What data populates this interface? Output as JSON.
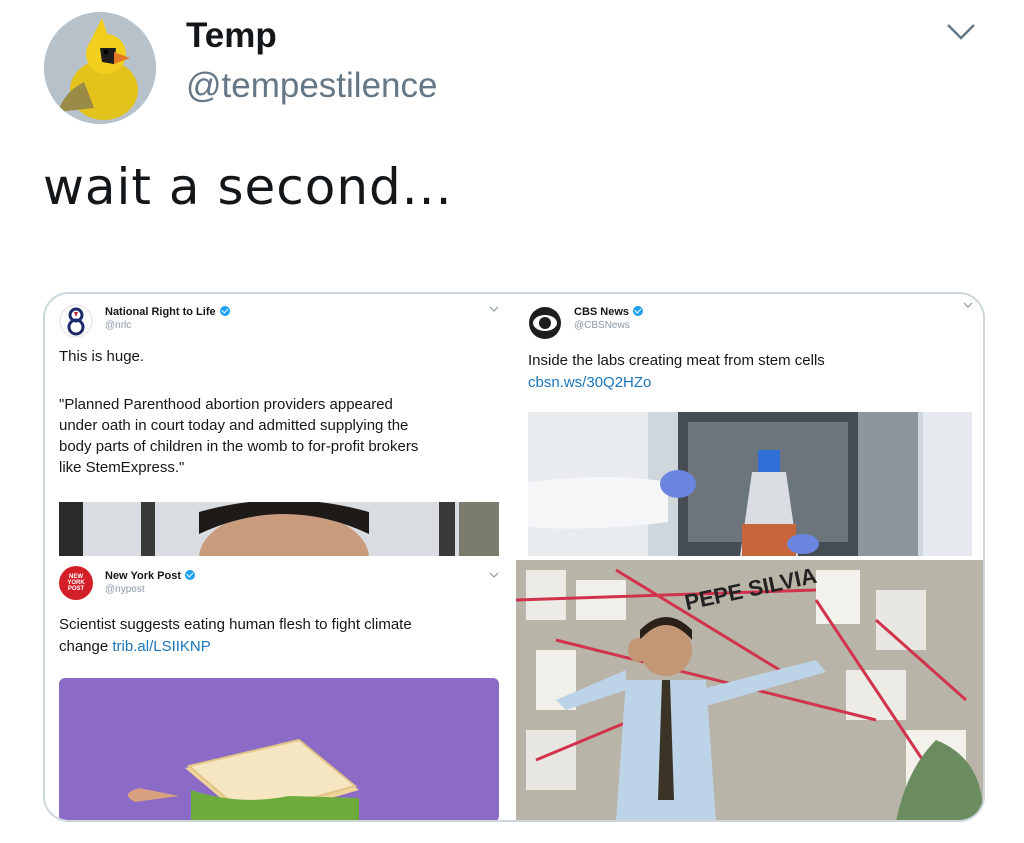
{
  "author": {
    "name": "Temp",
    "handle": "@tempestilence"
  },
  "tweet": {
    "text": "wait a second..."
  },
  "embedded": {
    "nrl": {
      "name": "National Right to Life",
      "handle": "@nrlc",
      "text_line1": "This is huge.",
      "quote_lines": [
        "\"Planned Parenthood abortion providers appeared",
        "under oath in court today and admitted supplying the",
        "body parts of children in the womb to for-profit brokers",
        "like StemExpress.\""
      ]
    },
    "cbs": {
      "name": "CBS News",
      "handle": "@CBSNews",
      "text": "Inside the labs creating meat from stem cells",
      "link": "cbsn.ws/30Q2HZo"
    },
    "nypost": {
      "name": "New York Post",
      "handle": "@nypost",
      "avatar_text": "NEW YORK POST",
      "text_line1": "Scientist suggests eating human flesh to fight climate",
      "text_line2": "change ",
      "link": "trib.al/LSIIKNP"
    },
    "meme": {
      "wall_text": "PEPE SILVIA"
    }
  },
  "icons": [
    "chevron-down-icon",
    "verified-badge-icon",
    "cardinal-bird-avatar",
    "nrl-logo-icon",
    "cbs-eye-logo-icon"
  ],
  "colors": {
    "link": "#1b75bb",
    "verified": "#1da1f2",
    "handle": "#657786",
    "border": "#ccd6dd",
    "nypost_red": "#d31f27"
  }
}
